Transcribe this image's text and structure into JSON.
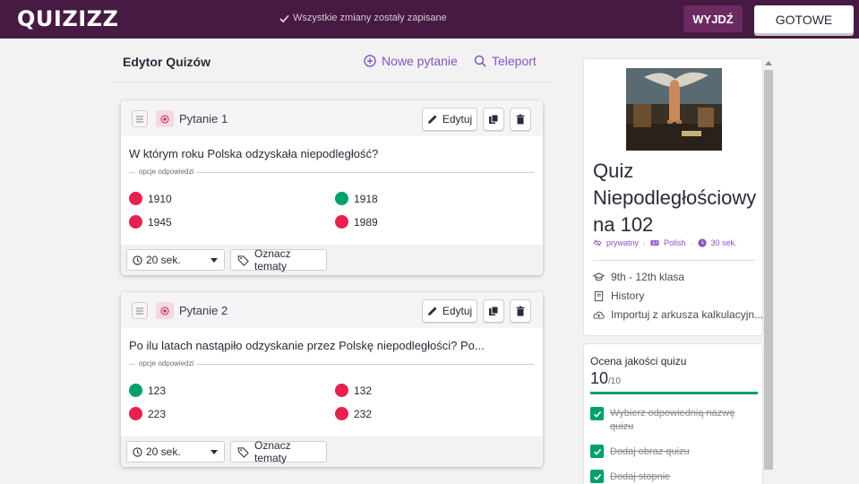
{
  "app": {
    "logo": "QUIZIZZ",
    "saved_status": "Wszystkie zmiany zostały zapisane"
  },
  "topbar": {
    "exit_label": "WYJDŹ",
    "done_label": "GOTOWE"
  },
  "editor": {
    "title": "Edytor Quizów",
    "new_question_label": "Nowe pytanie",
    "teleport_label": "Teleport"
  },
  "questions": [
    {
      "label": "Pytanie 1",
      "edit_label": "Edytuj",
      "text": "W którym roku Polska odzyskała niepodległość?",
      "options_label": "opcje odpowiedzi",
      "answers": [
        {
          "text": "1910",
          "correct": false
        },
        {
          "text": "1918",
          "correct": true
        },
        {
          "text": "1945",
          "correct": false
        },
        {
          "text": "1989",
          "correct": false
        }
      ],
      "time": "20 sek.",
      "tag_label": "Oznacz tematy"
    },
    {
      "label": "Pytanie 2",
      "edit_label": "Edytuj",
      "text": "Po ilu latach nastąpiło odzyskanie przez Polskę niepodległości? Po...",
      "options_label": "opcje odpowiedzi",
      "answers": [
        {
          "text": "123",
          "correct": true
        },
        {
          "text": "132",
          "correct": false
        },
        {
          "text": "223",
          "correct": false
        },
        {
          "text": "232",
          "correct": false
        }
      ],
      "time": "20 sek.",
      "tag_label": "Oznacz tematy"
    }
  ],
  "quiz": {
    "name": "Quiz Niepodległościowy na 102",
    "visibility": "prywatny",
    "language": "Polish",
    "time": "30 sek.",
    "grade": "9th - 12th klasa",
    "subject": "History",
    "import_label": "Importuj z arkusza kalkulacyjn..."
  },
  "quality": {
    "title": "Ocena jakości quizu",
    "score": "10",
    "max": "/10",
    "fraction": 1.0,
    "items": [
      "Wybierz odpowiednią nazwę quizu",
      "Dodaj obraz quizu",
      "Dodaj stopnie"
    ]
  },
  "colors": {
    "correct": "#00a06a",
    "incorrect": "#e5214f",
    "accent": "#8854c0",
    "topbar": "#461a42"
  }
}
